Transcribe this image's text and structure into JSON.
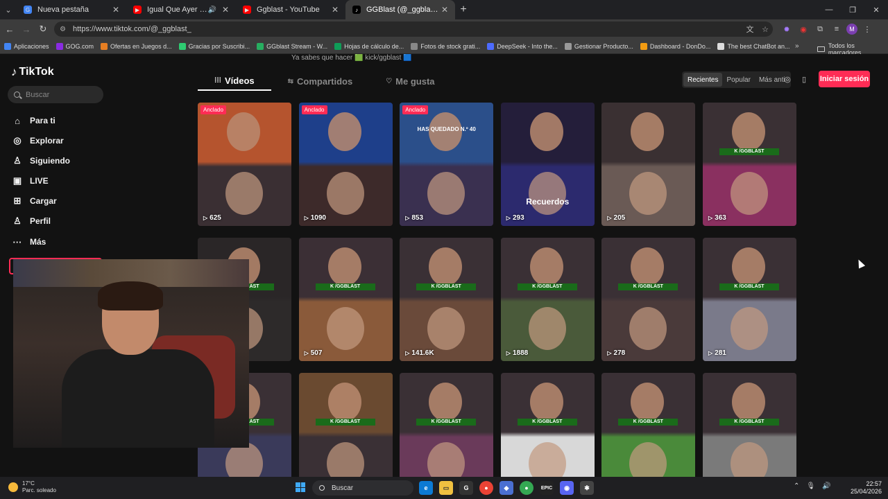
{
  "tabs": [
    {
      "title": "Nueva pestaña",
      "favcolor": "#4285f4",
      "favglyph": "G"
    },
    {
      "title": "Igual Que Ayer - YouTube",
      "favcolor": "#ff0000",
      "favglyph": "▶"
    },
    {
      "title": "Ggblast - YouTube",
      "favcolor": "#ff0000",
      "favglyph": "▶"
    },
    {
      "title": "GGBlast (@_ggblast_) | TikTok",
      "favcolor": "#000000",
      "favglyph": "♪"
    }
  ],
  "address": {
    "url": "https://www.tiktok.com/@_ggblast_"
  },
  "bookmarks": [
    {
      "label": "Aplicaciones",
      "color": "#4285f4"
    },
    {
      "label": "GOG.com",
      "color": "#8a2be2"
    },
    {
      "label": "Ofertas en Juegos d...",
      "color": "#e67e22"
    },
    {
      "label": "Gracias por Suscribi...",
      "color": "#2ecc71"
    },
    {
      "label": "GGblast Stream - W...",
      "color": "#27ae60"
    },
    {
      "label": "Hojas de cálculo de...",
      "color": "#0f9d58"
    },
    {
      "label": "Fotos de stock grati...",
      "color": "#888888"
    },
    {
      "label": "DeepSeek - Into the...",
      "color": "#4d6bfe"
    },
    {
      "label": "Gestionar Producto...",
      "color": "#999999"
    },
    {
      "label": "Dashboard - DonDo...",
      "color": "#f39c12"
    },
    {
      "label": "The best ChatBot an...",
      "color": "#dddddd"
    }
  ],
  "bookmarks_all": "Todos los marcadores",
  "tiktok": {
    "logo": "TikTok",
    "search_placeholder": "Buscar",
    "nav": [
      {
        "label": "Para ti",
        "icon": "home-icon",
        "glyph": "⌂"
      },
      {
        "label": "Explorar",
        "icon": "compass-icon",
        "glyph": "◎"
      },
      {
        "label": "Siguiendo",
        "icon": "following-icon",
        "glyph": "♙"
      },
      {
        "label": "LIVE",
        "icon": "live-icon",
        "glyph": "▣"
      },
      {
        "label": "Cargar",
        "icon": "upload-icon",
        "glyph": "⊞"
      },
      {
        "label": "Perfil",
        "icon": "profile-icon",
        "glyph": "♙"
      },
      {
        "label": "Más",
        "icon": "more-icon",
        "glyph": "···"
      }
    ],
    "bio_snippet": "Ya sabes que hacer 🟩 kick/ggblast 🟦",
    "profile_tabs": [
      {
        "label": "Vídeos",
        "glyph": "⁞⁞⁞"
      },
      {
        "label": "Compartidos",
        "glyph": "⇆"
      },
      {
        "label": "Me gusta",
        "glyph": "♡"
      }
    ],
    "sort": [
      "Recientes",
      "Popular",
      "Más anti"
    ],
    "login_label": "Iniciar sesión",
    "pinned_label": "Anclado",
    "videos": [
      {
        "views": "625",
        "pinned": true,
        "c1": "#b5542e",
        "c2": "#3a2f33"
      },
      {
        "views": "1090",
        "pinned": true,
        "c1": "#1e3f8a",
        "c2": "#3d2a2a"
      },
      {
        "views": "853",
        "pinned": true,
        "c1": "#2b4f8a",
        "c2": "#3a3050",
        "overlay": "HAS QUEDADO N.º 40"
      },
      {
        "views": "293",
        "pinned": false,
        "c1": "#241e3a",
        "c2": "#2c2a6e",
        "overlay": "Recuerdos"
      },
      {
        "views": "205",
        "pinned": false,
        "c1": "#3a3032",
        "c2": "#6a5a55"
      },
      {
        "views": "363",
        "pinned": false,
        "c1": "#3a3034",
        "c2": "#8a3060"
      },
      {
        "views": "",
        "pinned": false,
        "c1": "#2a2627",
        "c2": "#2d2a2a"
      },
      {
        "views": "507",
        "pinned": false,
        "c1": "#3b2f35",
        "c2": "#8a5a3a"
      },
      {
        "views": "141.6K",
        "pinned": false,
        "c1": "#3a3035",
        "c2": "#6a4a3a"
      },
      {
        "views": "1888",
        "pinned": false,
        "c1": "#3a3035",
        "c2": "#4a5a3a"
      },
      {
        "views": "278",
        "pinned": false,
        "c1": "#3a3035",
        "c2": "#4a3a3a"
      },
      {
        "views": "281",
        "pinned": false,
        "c1": "#3a3035",
        "c2": "#7a7a8a"
      },
      {
        "views": "",
        "pinned": false,
        "c1": "#3a3035",
        "c2": "#3a3a5a"
      },
      {
        "views": "",
        "pinned": false,
        "c1": "#6a4a30",
        "c2": "#3a3035"
      },
      {
        "views": "",
        "pinned": false,
        "c1": "#3a3035",
        "c2": "#6a3a5a"
      },
      {
        "views": "",
        "pinned": false,
        "c1": "#3a3035",
        "c2": "#d8d8d8"
      },
      {
        "views": "",
        "pinned": false,
        "c1": "#3a3035",
        "c2": "#4a8a3a"
      },
      {
        "views": "",
        "pinned": false,
        "c1": "#3a3035",
        "c2": "#7a7a7a"
      }
    ],
    "gg_tag": "K /GGBLAST"
  },
  "taskbar": {
    "temp": "17°C",
    "weather": "Parc. soleado",
    "search": "Buscar",
    "time": "22:57",
    "date": "25/04/2026"
  }
}
